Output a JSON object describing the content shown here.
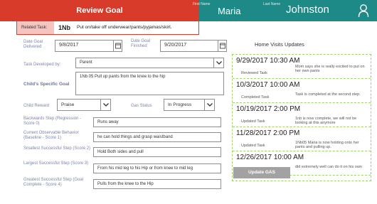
{
  "header": {
    "title": "Review Goal",
    "first_name_label": "First Name",
    "first_name": "Maria",
    "last_name_label": "Last Name",
    "last_name": "Johnston",
    "user_icon": "user-icon"
  },
  "related": {
    "label": "Related Task:",
    "code": "1Nb",
    "description": "Put on/take off underwear/pants/pyjamas/skirt."
  },
  "form": {
    "date_delivered_label": "Date Goal Delivered",
    "date_delivered": "9/8/2017",
    "date_finished_label": "Date Goal Finished",
    "date_finished": "9/20/2017",
    "developed_by_label": "Task Developed by:",
    "developed_by": "Parent",
    "specific_goal_label": "Child's Specific Goal",
    "specific_goal": "1Nb 05 Pull up pants from the knee to the hip",
    "child_reward_label": "Child Reward",
    "child_reward": "Praise",
    "gas_status_label": "Gas Status",
    "gas_status": "In Progress",
    "backwards_step_label": "Backwards Step (Regression - Score 0)",
    "backwards_step": "Runs away",
    "current_label": "Current Observable Behavior (Baseline - Score 1)",
    "current": "he can hold things and grasp waistband",
    "smallest_label": "Smallest Successful Step (Score 2)",
    "smallest": "Hold Both sides and pull",
    "largest_label": "Largest Successful Step (Score 3)",
    "largest": "From his mid leg to his Hip  or from knee to mid leg",
    "greatest_label": "Greatest Successful Step (Goal Complete - Score 4)",
    "greatest": "Pulls from the knee to the Hip"
  },
  "visits": {
    "title": "Home Visits Updates",
    "items": [
      {
        "date": "9/29/2017 10:30 AM",
        "type": "Reviewed Task",
        "note": "Mom says she is really excited to put on her own pants"
      },
      {
        "date": "10/3/2017 10:00 AM",
        "type": "Completed Task",
        "note": "Task is completed at the second step."
      },
      {
        "date": "10/19/2017 2:00 PM",
        "type": "Updated Task",
        "note": "1nb is now complete, we will not be looking at this anymore"
      },
      {
        "date": "11/28/2017 2:00 PM",
        "type": "Updated Task",
        "note": "1Nb05 Maria is now holding onto her pants and pulling up."
      },
      {
        "date": "12/26/2017 10:00 AM",
        "type": "Updated Task",
        "note": "did extremely well can do it on his own"
      }
    ]
  },
  "actions": {
    "update_gas": "Update GAS"
  },
  "colors": {
    "title_red": "#d93b2a",
    "teal": "#1d8a87",
    "border_green": "#9fd46b",
    "button_gray": "#a2a2a2"
  }
}
